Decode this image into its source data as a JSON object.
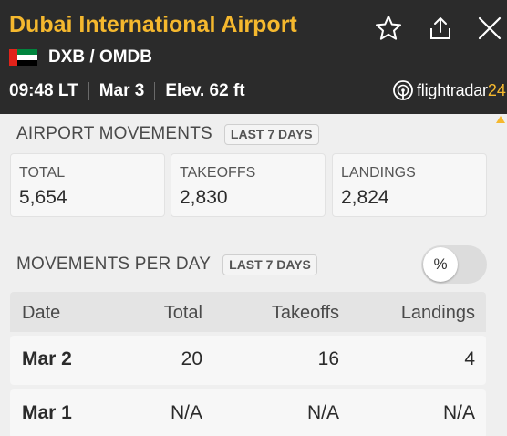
{
  "header": {
    "title": "Dubai International Airport",
    "codes": "DXB / OMDB",
    "local_time": "09:48 LT",
    "date": "Mar 3",
    "elevation": "Elev. 62 ft",
    "flag_colors": {
      "red": "#e2231a",
      "green": "#00843d",
      "white": "#ffffff",
      "black": "#000000"
    },
    "icons": [
      "star-icon",
      "share-icon",
      "close-icon"
    ],
    "brand": {
      "name": "flightradar",
      "suffix": "24"
    }
  },
  "movements": {
    "title": "AIRPORT MOVEMENTS",
    "period_badge": "LAST 7 DAYS",
    "stats": [
      {
        "label": "TOTAL",
        "value": "5,654"
      },
      {
        "label": "TAKEOFFS",
        "value": "2,830"
      },
      {
        "label": "LANDINGS",
        "value": "2,824"
      }
    ]
  },
  "per_day": {
    "title": "MOVEMENTS PER DAY",
    "period_badge": "LAST 7 DAYS",
    "toggle_label": "%",
    "columns": [
      "Date",
      "Total",
      "Takeoffs",
      "Landings"
    ],
    "rows": [
      [
        "Mar 2",
        "20",
        "16",
        "4"
      ],
      [
        "Mar 1",
        "N/A",
        "N/A",
        "N/A"
      ]
    ]
  },
  "colors": {
    "accent": "#f5b82e",
    "header_bg": "#2b2b2b",
    "page_bg": "#efefef"
  }
}
